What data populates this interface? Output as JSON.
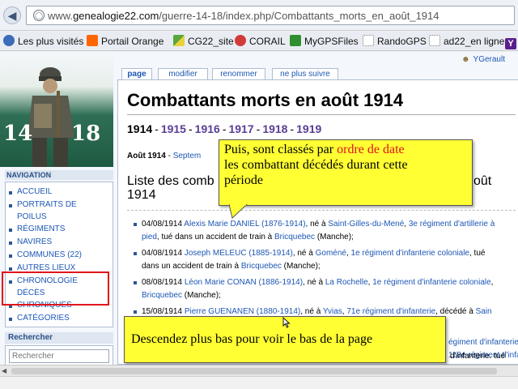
{
  "browser": {
    "url_prefix": "www.",
    "url_domain": "genealogie22.com",
    "url_path": "/guerre-14-18/index.php/Combattants_morts_en_août_1914"
  },
  "bookmarks": [
    {
      "label": "Les plus visités",
      "icon": "gear-icon",
      "color": "#3b6cb7"
    },
    {
      "label": "Portail Orange",
      "icon": "orange-logo-icon",
      "color": "#ff6600"
    },
    {
      "label": "CG22_site",
      "icon": "cg22-icon",
      "color": "#5aa63c"
    },
    {
      "label": "CORAIL",
      "icon": "corail-icon",
      "color": "#d23a3a"
    },
    {
      "label": "MyGPSFiles",
      "icon": "mygps-icon",
      "color": "#2f8f2f"
    },
    {
      "label": "RandoGPS",
      "icon": "page-icon",
      "color": "#ffffff"
    },
    {
      "label": "ad22_en ligne",
      "icon": "page-icon",
      "color": "#ffffff"
    },
    {
      "label": "Y",
      "icon": "yahoo-icon",
      "color": "#5b1f8c"
    }
  ],
  "logo": {
    "left_number": "14",
    "right_number": "18"
  },
  "user": {
    "name": "YGerault"
  },
  "tabs": [
    {
      "label": "page"
    },
    {
      "label": "modifier"
    },
    {
      "label": "renommer"
    },
    {
      "label": "ne plus suivre"
    }
  ],
  "sidebar": {
    "heading": "Navigation",
    "items": [
      {
        "label": "Accueil"
      },
      {
        "label": "Portraits de"
      },
      {
        "label": "poilus"
      },
      {
        "label": "Régiments"
      },
      {
        "label": "Navires"
      },
      {
        "label": "Communes (22)"
      },
      {
        "label": "Autres lieux"
      },
      {
        "label": "Chronologie"
      },
      {
        "label": "décès"
      },
      {
        "label": "Chroniques"
      },
      {
        "label": "Catégories"
      }
    ],
    "search_heading": "Rechercher",
    "search_placeholder": "Rechercher"
  },
  "content": {
    "title": "Combattants morts en août 1914",
    "years": [
      "1914",
      "1915",
      "1916",
      "1917",
      "1918",
      "1919"
    ],
    "years_separator": "-",
    "month_current": "Août 1914",
    "month_separator": " - ",
    "month_next": "Septem",
    "section_heading_line1": "Liste des comb",
    "section_heading_line1_end": "oût",
    "section_heading_line2": "1914",
    "entries": [
      {
        "date": "04/08/1914",
        "name": "Alexis Marie DANIEL (1876-1914)",
        "born": ", né à ",
        "place": "Saint-Gilles-du-Mené",
        "regiment": "3e régiment d'artillerie à",
        "regiment_cont": "pied",
        "detail": ", tué dans un accident de train à ",
        "detail_place": "Bricquebec",
        "detail_end": " (Manche);"
      },
      {
        "date": "04/08/1914",
        "name": "Joseph MELEUC (1885-1914)",
        "born": ", né à ",
        "place": "Goméné",
        "regiment": "1e régiment d'infanterie coloniale",
        "regiment_cont": "",
        "detail": ", tué",
        "detail_place": "",
        "detail_end": "",
        "line2": "dans un accident de train à ",
        "line2_place": "Bricquebec",
        "line2_end": " (Manche);"
      },
      {
        "date": "08/08/1914",
        "name": "Léon Marie CONAN (1886-1914)",
        "born": ", né à ",
        "place": "La Rochelle",
        "regiment": "1e régiment d'infanterie coloniale",
        "regiment_cont": "",
        "detail": ",",
        "detail_place": "",
        "detail_end": "",
        "line2": "",
        "line2_place": "Bricquebec",
        "line2_end": " (Manche);"
      },
      {
        "date": "15/08/1914",
        "name": "Pierre GUENANEN (1880-1914)",
        "born": ", né à ",
        "place": "Yvias",
        "regiment": "71e régiment d'infanterie",
        "regiment_cont": "",
        "detail": ", décédé à ",
        "detail_place": "Sain",
        "detail_end": ""
      }
    ],
    "hidden_fragments": [
      {
        "text": "égiment d'infanterie,"
      },
      {
        "text": "118e régiment d'infanterie"
      },
      {
        "text": "d'infanterie. tué"
      }
    ]
  },
  "callouts": {
    "top_line1_start": "Puis, sont classés par ",
    "top_line1_red": "ordre de date",
    "top_line2": "les combattant décédés durant cette",
    "top_line3": "période",
    "bottom": "Descendez plus bas pour voir le bas de la page"
  },
  "colors": {
    "link": "#1d57b5",
    "visited_year": "#5a3e95",
    "callout_bg": "#ffff33",
    "callout_red": "#e0141b",
    "highlight_box": "#e0151b"
  }
}
